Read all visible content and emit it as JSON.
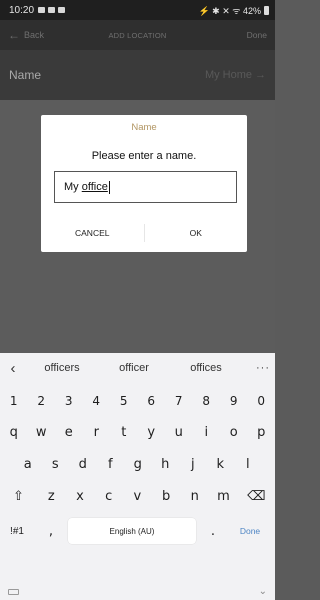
{
  "status": {
    "time": "10:20",
    "right_text": "⚡ ✱ ✕ ᯤ 42%"
  },
  "app_bar": {
    "back_label": "Back",
    "title": "ADD LOCATION",
    "done_label": "Done"
  },
  "name_row": {
    "label": "Name",
    "value": "My Home"
  },
  "dialog": {
    "title": "Name",
    "message": "Please enter a name.",
    "input_prefix": "My ",
    "input_underlined": "office",
    "cancel_label": "CANCEL",
    "ok_label": "OK"
  },
  "keyboard": {
    "suggestions": [
      "officers",
      "officer",
      "offices"
    ],
    "more": "···",
    "numbers": [
      "1",
      "2",
      "3",
      "4",
      "5",
      "6",
      "7",
      "8",
      "9",
      "0"
    ],
    "row_q": [
      "q",
      "w",
      "e",
      "r",
      "t",
      "y",
      "u",
      "i",
      "o",
      "p"
    ],
    "row_a": [
      "a",
      "s",
      "d",
      "f",
      "g",
      "h",
      "j",
      "k",
      "l"
    ],
    "row_z": [
      "z",
      "x",
      "c",
      "v",
      "b",
      "n",
      "m"
    ],
    "symbols_label": "!#1",
    "comma": ",",
    "space_label": "English (AU)",
    "period": ".",
    "done_label": "Done"
  },
  "colors": {
    "dialog_title": "#b29663",
    "done_key": "#4f86c4"
  }
}
